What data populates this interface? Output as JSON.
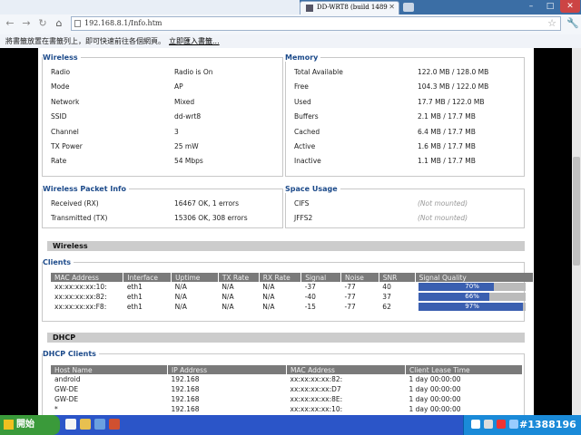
{
  "browser": {
    "tab_title": "DD-WRT8 (build 14896)...",
    "url": "192.168.8.1/Info.htm",
    "infobar_message": "將書籤放置在書籤列上，即可快速前往各個網頁。",
    "infobar_link": "立即匯入書籤..."
  },
  "wireless_box": {
    "title": "Wireless",
    "rows": [
      {
        "label": "Radio",
        "value": "Radio is On"
      },
      {
        "label": "Mode",
        "value": "AP"
      },
      {
        "label": "Network",
        "value": "Mixed"
      },
      {
        "label": "SSID",
        "value": "dd-wrt8"
      },
      {
        "label": "Channel",
        "value": "3"
      },
      {
        "label": "TX Power",
        "value": "25 mW"
      },
      {
        "label": "Rate",
        "value": "54 Mbps"
      }
    ]
  },
  "memory_box": {
    "title": "Memory",
    "rows": [
      {
        "label": "Total Available",
        "value": "122.0 MB / 128.0 MB"
      },
      {
        "label": "Free",
        "value": "104.3 MB / 122.0 MB"
      },
      {
        "label": "Used",
        "value": "17.7 MB / 122.0 MB"
      },
      {
        "label": "Buffers",
        "value": "2.1 MB / 17.7 MB"
      },
      {
        "label": "Cached",
        "value": "6.4 MB / 17.7 MB"
      },
      {
        "label": "Active",
        "value": "1.6 MB / 17.7 MB"
      },
      {
        "label": "Inactive",
        "value": "1.1 MB / 17.7 MB"
      }
    ]
  },
  "packet_box": {
    "title": "Wireless Packet Info",
    "rows": [
      {
        "label": "Received (RX)",
        "value": "16467 OK, 1 errors"
      },
      {
        "label": "Transmitted (TX)",
        "value": "15306 OK, 308 errors"
      }
    ]
  },
  "space_box": {
    "title": "Space Usage",
    "rows": [
      {
        "label": "CIFS",
        "value": "(Not mounted)"
      },
      {
        "label": "JFFS2",
        "value": "(Not mounted)"
      }
    ]
  },
  "wireless_section": "Wireless",
  "clients": {
    "title": "Clients",
    "headers": [
      "MAC Address",
      "Interface",
      "Uptime",
      "TX Rate",
      "RX Rate",
      "Signal",
      "Noise",
      "SNR",
      "Signal Quality"
    ],
    "rows": [
      {
        "mac": "xx:xx:xx:xx:10:",
        "iface": "eth1",
        "uptime": "N/A",
        "tx": "N/A",
        "rx": "N/A",
        "signal": "-37",
        "noise": "-77",
        "snr": "40",
        "quality": 70,
        "quality_label": "70%"
      },
      {
        "mac": "xx:xx:xx:xx:82:",
        "iface": "eth1",
        "uptime": "N/A",
        "tx": "N/A",
        "rx": "N/A",
        "signal": "-40",
        "noise": "-77",
        "snr": "37",
        "quality": 66,
        "quality_label": "66%"
      },
      {
        "mac": "xx:xx:xx:xx:F8:",
        "iface": "eth1",
        "uptime": "N/A",
        "tx": "N/A",
        "rx": "N/A",
        "signal": "-15",
        "noise": "-77",
        "snr": "62",
        "quality": 97,
        "quality_label": "97%"
      }
    ]
  },
  "dhcp_section": "DHCP",
  "dhcp_clients": {
    "title": "DHCP Clients",
    "headers": [
      "Host Name",
      "IP Address",
      "MAC Address",
      "Client Lease Time"
    ],
    "rows": [
      {
        "host": "android",
        "ip": "192.168",
        "mac": "xx:xx:xx:xx:82:",
        "lease": "1 day 00:00:00"
      },
      {
        "host": "GW-DE",
        "ip": "192.168",
        "mac": "xx:xx:xx:xx:D7",
        "lease": "1 day 00:00:00"
      },
      {
        "host": "GW-DE",
        "ip": "192.168",
        "mac": "xx:xx:xx:xx:8E:",
        "lease": "1 day 00:00:00"
      },
      {
        "host": "*",
        "ip": "192.168",
        "mac": "xx:xx:xx:xx:10:",
        "lease": "1 day 00:00:00"
      }
    ]
  },
  "taskbar": {
    "start_label": "開始",
    "watermark": "#1388196"
  },
  "colors": {
    "section_title": "#1c4a8a",
    "quality_bar": "#3a5fb0",
    "taskbar": "#2b55c8"
  }
}
